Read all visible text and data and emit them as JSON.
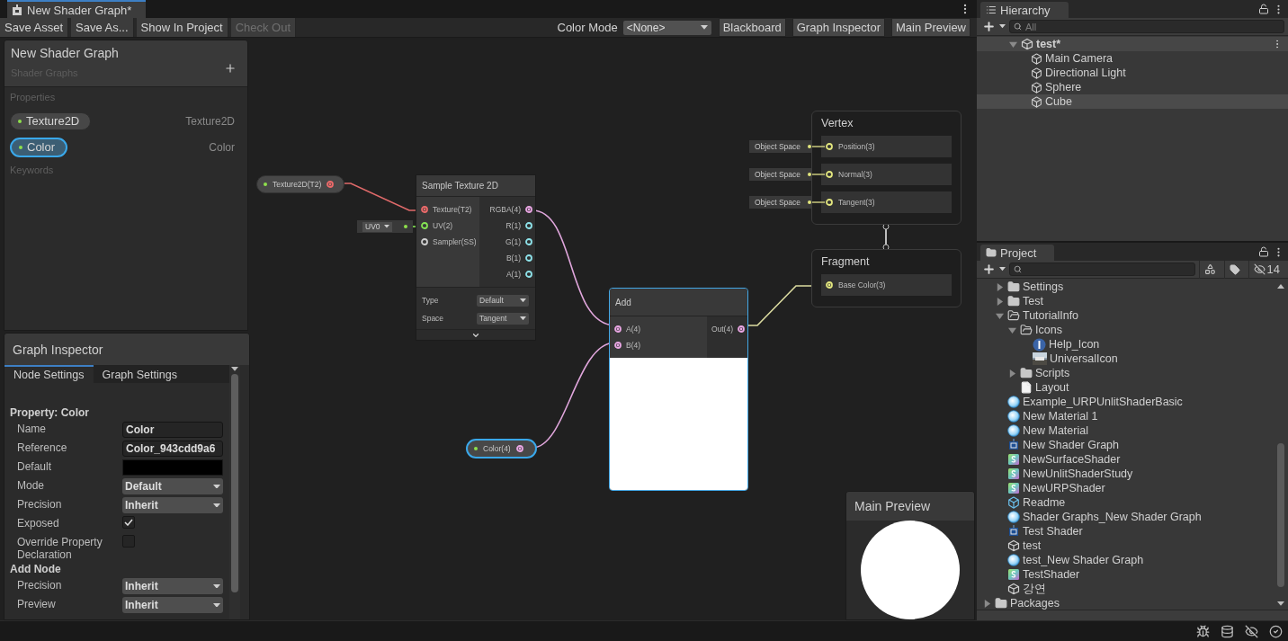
{
  "window": {
    "title": "New Shader Graph*"
  },
  "toolbar": {
    "actions": [
      {
        "label": "Save Asset",
        "disabled": false
      },
      {
        "label": "Save As...",
        "disabled": false
      },
      {
        "label": "Show In Project",
        "disabled": false
      },
      {
        "label": "Check Out",
        "disabled": true
      }
    ],
    "color_mode": {
      "label": "Color Mode",
      "value": "<None>"
    },
    "toggles": [
      {
        "label": "Blackboard",
        "on": true
      },
      {
        "label": "Graph Inspector",
        "on": true
      },
      {
        "label": "Main Preview",
        "on": true
      }
    ]
  },
  "blackboard": {
    "title": "New Shader Graph",
    "subtitle": "Shader Graphs",
    "sections": [
      {
        "title": "Properties",
        "items": [
          {
            "name": "Texture2D",
            "type": "Texture2D",
            "selected": false
          },
          {
            "name": "Color",
            "type": "Color",
            "selected": true
          }
        ]
      },
      {
        "title": "Keywords"
      }
    ]
  },
  "inspector": {
    "title": "Graph Inspector",
    "tabs": [
      {
        "label": "Node Settings",
        "selected": true
      },
      {
        "label": "Graph Settings",
        "selected": false
      }
    ],
    "groups": [
      {
        "title": "Property: Color",
        "fields": [
          {
            "kind": "text",
            "label": "Name",
            "value": "Color"
          },
          {
            "kind": "text",
            "label": "Reference",
            "value": "Color_943cdd9a6"
          },
          {
            "kind": "color",
            "label": "Default"
          },
          {
            "kind": "dropdown",
            "label": "Mode",
            "value": "Default"
          },
          {
            "kind": "dropdown",
            "label": "Precision",
            "value": "Inherit"
          },
          {
            "kind": "checkbox",
            "label": "Exposed",
            "checked": true
          },
          {
            "kind": "checkbox",
            "label": "Override Property Declaration",
            "checked": false
          }
        ]
      },
      {
        "title": "Add Node",
        "fields": [
          {
            "kind": "dropdown",
            "label": "Precision",
            "value": "Inherit"
          },
          {
            "kind": "dropdown",
            "label": "Preview",
            "value": "Inherit"
          }
        ]
      }
    ]
  },
  "graph": {
    "texture_property": {
      "label": "Texture2D(T2)",
      "selected": false,
      "port": {
        "color": "#ec6a6a",
        "connected": true
      }
    },
    "uv_input": {
      "value": "UV0"
    },
    "sample_texture": {
      "title": "Sample Texture 2D",
      "inputs": [
        {
          "label": "Texture(T2)",
          "color": "#ec6a6a",
          "connected": true
        },
        {
          "label": "UV(2)",
          "color": "#84e454",
          "connected": false
        },
        {
          "label": "Sampler(SS)",
          "color": "#cfcfcf",
          "connected": false
        }
      ],
      "outputs": [
        {
          "label": "RGBA(4)",
          "color": "#e9a6e3",
          "connected": true
        },
        {
          "label": "R(1)",
          "color": "#8ee3ea",
          "connected": false
        },
        {
          "label": "G(1)",
          "color": "#8ee3ea",
          "connected": false
        },
        {
          "label": "B(1)",
          "color": "#8ee3ea",
          "connected": false
        },
        {
          "label": "A(1)",
          "color": "#8ee3ea",
          "connected": false
        }
      ],
      "settings": [
        {
          "label": "Type",
          "value": "Default"
        },
        {
          "label": "Space",
          "value": "Tangent"
        }
      ]
    },
    "add": {
      "title": "Add",
      "selected": true,
      "inputs": [
        {
          "label": "A(4)",
          "color": "#e9a6e3",
          "connected": true
        },
        {
          "label": "B(4)",
          "color": "#e9a6e3",
          "connected": true
        }
      ],
      "outputs": [
        {
          "label": "Out(4)",
          "color": "#e9a6e3",
          "connected": true
        }
      ]
    },
    "color_property": {
      "label": "Color(4)",
      "selected": true,
      "port": {
        "color": "#e9a6e3",
        "connected": true
      }
    },
    "vertex": {
      "title": "Vertex",
      "blocks": [
        {
          "label": "Position(3)",
          "space": "Object Space",
          "color": "#e2e67e",
          "connected": false
        },
        {
          "label": "Normal(3)",
          "space": "Object Space",
          "color": "#e2e67e",
          "connected": false
        },
        {
          "label": "Tangent(3)",
          "space": "Object Space",
          "color": "#e2e67e",
          "connected": false
        }
      ]
    },
    "fragment": {
      "title": "Fragment",
      "blocks": [
        {
          "label": "Base Color(3)",
          "color": "#e2e67e",
          "connected": true
        }
      ]
    }
  },
  "main_preview": {
    "title": "Main Preview"
  },
  "hierarchy": {
    "title": "Hierarchy",
    "search_placeholder": "All",
    "scene": {
      "name": "test*",
      "expanded": true,
      "children": [
        {
          "name": "Main Camera",
          "selected": false
        },
        {
          "name": "Directional Light",
          "selected": false
        },
        {
          "name": "Sphere",
          "selected": false
        },
        {
          "name": "Cube",
          "selected": true
        }
      ]
    }
  },
  "project": {
    "title": "Project",
    "hidden_count": "14",
    "items": [
      {
        "name": "Settings",
        "kind": "folder",
        "expanded": false
      },
      {
        "name": "Test",
        "kind": "folder",
        "expanded": false
      },
      {
        "name": "TutorialInfo",
        "kind": "folder",
        "expanded": true,
        "children": [
          {
            "name": "Icons",
            "kind": "folder",
            "expanded": true,
            "children": [
              {
                "name": "Help_Icon",
                "kind": "info"
              },
              {
                "name": "UniversalIcon",
                "kind": "texture"
              }
            ]
          },
          {
            "name": "Scripts",
            "kind": "folder",
            "expanded": false
          },
          {
            "name": "Layout",
            "kind": "file"
          }
        ]
      },
      {
        "name": "Example_URPUnlitShaderBasic",
        "kind": "material"
      },
      {
        "name": "New Material 1",
        "kind": "material"
      },
      {
        "name": "New Material",
        "kind": "material"
      },
      {
        "name": "New Shader Graph",
        "kind": "shadergraph"
      },
      {
        "name": "NewSurfaceShader",
        "kind": "shader"
      },
      {
        "name": "NewUnlitShaderStudy",
        "kind": "shader"
      },
      {
        "name": "NewURPShader",
        "kind": "shader"
      },
      {
        "name": "Readme",
        "kind": "readme"
      },
      {
        "name": "Shader Graphs_New Shader Graph",
        "kind": "material"
      },
      {
        "name": "Test Shader",
        "kind": "shadergraph"
      },
      {
        "name": "test",
        "kind": "scene"
      },
      {
        "name": "test_New Shader Graph",
        "kind": "material"
      },
      {
        "name": "TestShader",
        "kind": "shader"
      },
      {
        "name": "강연",
        "kind": "scene"
      }
    ],
    "root_items": [
      {
        "name": "Packages",
        "kind": "folder",
        "expanded": false
      }
    ]
  }
}
